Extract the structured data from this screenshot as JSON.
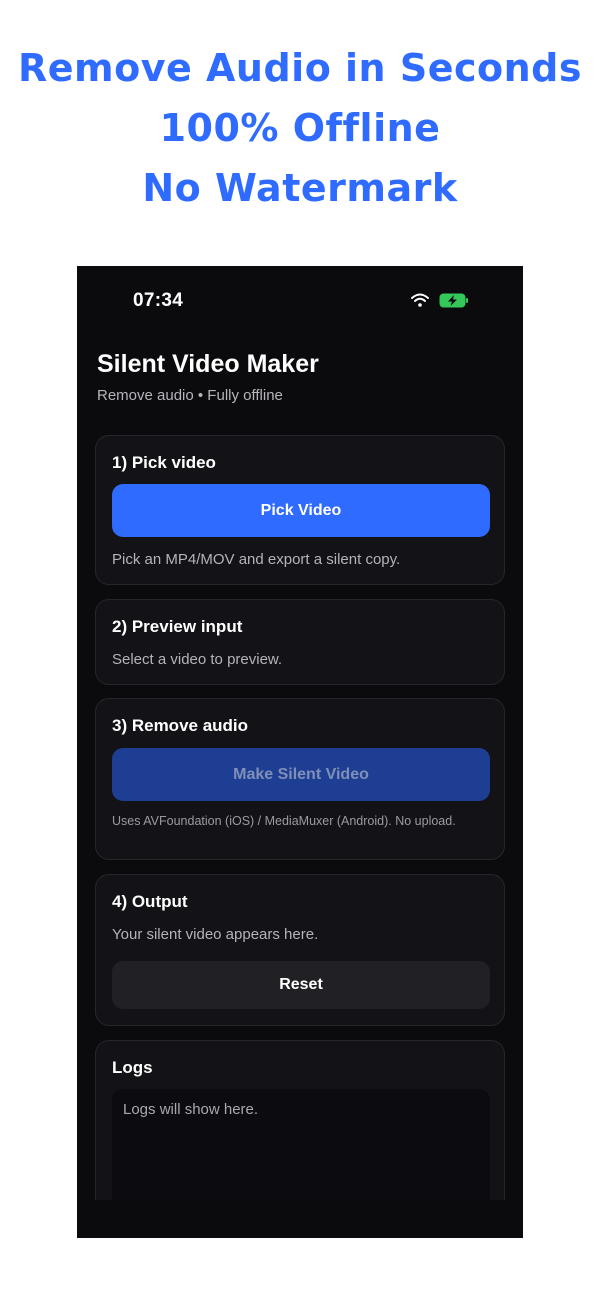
{
  "promo": {
    "line1": "Remove Audio in Seconds",
    "line2": "100% Offline",
    "line3": "No Watermark",
    "color": "#2f6bff"
  },
  "status_bar": {
    "time": "07:34",
    "icons": [
      "wifi-icon",
      "battery-charging-icon"
    ]
  },
  "header": {
    "title": "Silent Video Maker",
    "subtitle": "Remove audio • Fully offline"
  },
  "cards": {
    "pick": {
      "title": "1) Pick video",
      "button_label": "Pick Video",
      "hint": "Pick an MP4/MOV and export a silent copy."
    },
    "preview": {
      "title": "2) Preview input",
      "hint": "Select a video to preview."
    },
    "remove": {
      "title": "3) Remove audio",
      "button_label": "Make Silent Video",
      "note": "Uses AVFoundation (iOS) / MediaMuxer (Android). No upload."
    },
    "output": {
      "title": "4) Output",
      "hint": "Your silent video appears here.",
      "reset_label": "Reset"
    },
    "logs": {
      "title": "Logs",
      "placeholder": "Logs will show here."
    }
  },
  "colors": {
    "accent": "#2f6bff",
    "background": "#0b0b0e",
    "card": "#131317",
    "battery_charge": "#34c759"
  }
}
